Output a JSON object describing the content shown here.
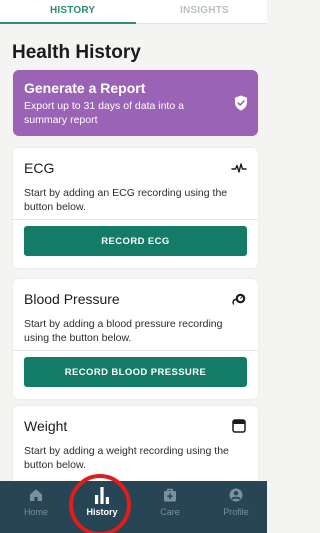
{
  "tabs": {
    "history": "HISTORY",
    "insights": "INSIGHTS"
  },
  "page": {
    "title": "Health History"
  },
  "report": {
    "title": "Generate a Report",
    "description": "Export up to 31 days of data into a summary report",
    "icon": "shield-check-icon"
  },
  "cards": [
    {
      "title": "ECG",
      "description": "Start by adding an ECG recording using the button below.",
      "button": "RECORD ECG",
      "icon": "heartbeat-icon"
    },
    {
      "title": "Blood Pressure",
      "description": "Start by adding a blood pressure recording using the button below.",
      "button": "RECORD BLOOD PRESSURE",
      "icon": "blood-pressure-cuff-icon"
    },
    {
      "title": "Weight",
      "description": "Start by adding a weight recording using the button below.",
      "icon": "scale-icon"
    }
  ],
  "nav": [
    {
      "label": "Home",
      "icon": "home-icon"
    },
    {
      "label": "History",
      "icon": "bar-chart-icon"
    },
    {
      "label": "Care",
      "icon": "medical-bag-icon"
    },
    {
      "label": "Profile",
      "icon": "profile-icon"
    }
  ],
  "colors": {
    "accent": "#2e8b74",
    "button": "#137b66",
    "report": "#9b63b6",
    "nav_bg": "#274554",
    "highlight": "#e21b1b"
  }
}
